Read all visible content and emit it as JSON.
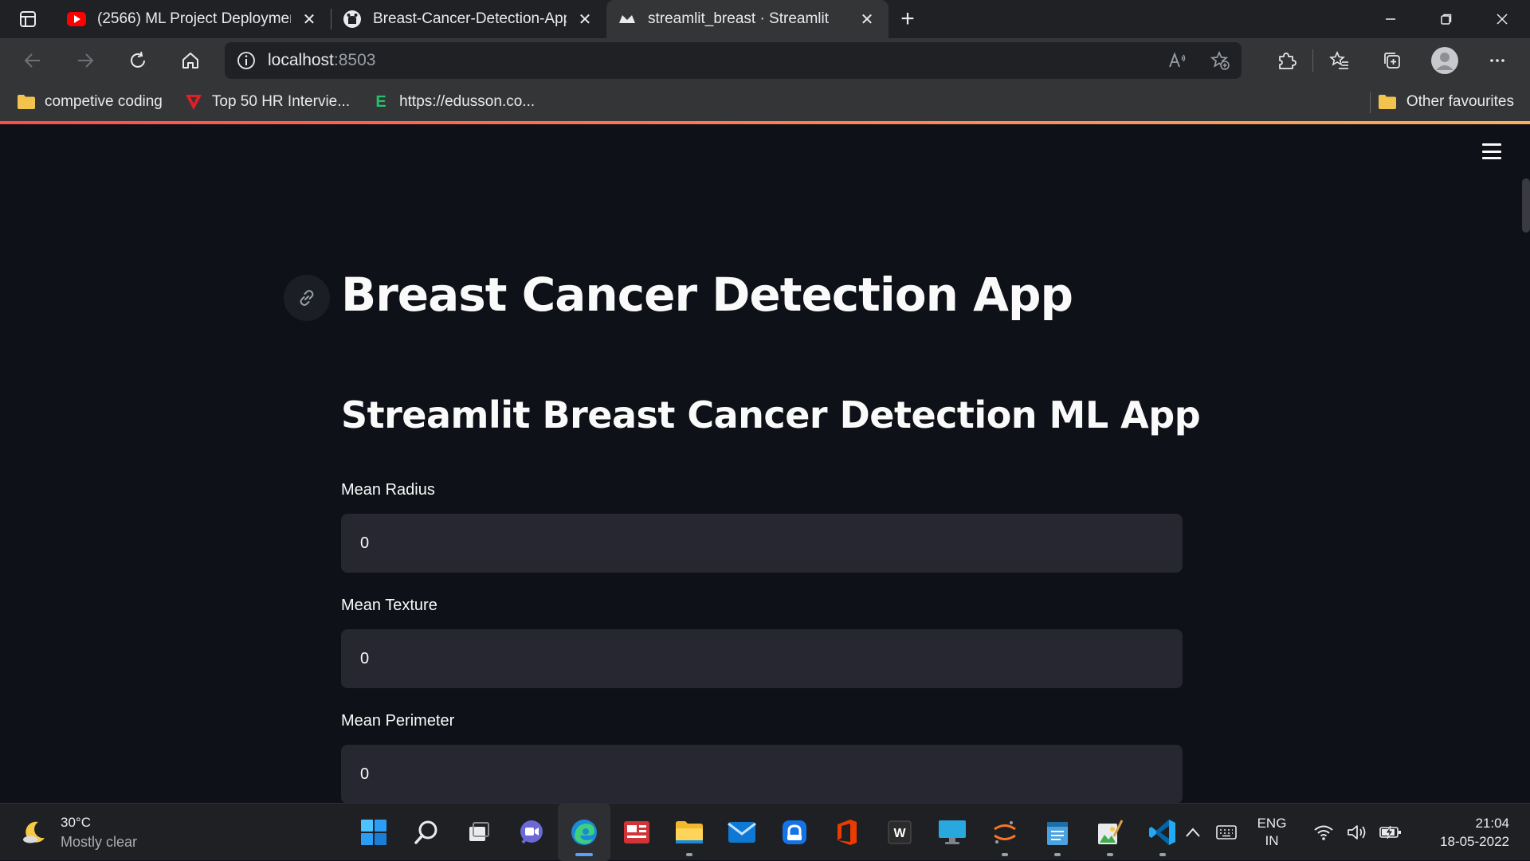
{
  "browser": {
    "tabs": [
      {
        "title": "(2566) ML Project Deployment U",
        "icon": "youtube-icon"
      },
      {
        "title": "Breast-Cancer-Detection-App/ap",
        "icon": "github-icon"
      },
      {
        "title": "streamlit_breast · Streamlit",
        "icon": "streamlit-icon",
        "active": true
      }
    ],
    "url_host": "localhost",
    "url_port": ":8503",
    "bookmarks": [
      {
        "label": "competive coding",
        "icon": "folder-icon"
      },
      {
        "label": "Top 50 HR Intervie...",
        "icon": "v-logo-icon"
      },
      {
        "label": "https://edusson.co...",
        "icon": "e-logo-icon"
      }
    ],
    "other_favourites": "Other favourites"
  },
  "app": {
    "title": "Breast Cancer Detection App",
    "subtitle": "Streamlit Breast Cancer Detection ML App",
    "fields": [
      {
        "label": "Mean Radius",
        "value": "0"
      },
      {
        "label": "Mean Texture",
        "value": "0"
      },
      {
        "label": "Mean Perimeter",
        "value": "0"
      }
    ]
  },
  "taskbar": {
    "weather_temp": "30°C",
    "weather_cond": "Mostly clear",
    "lang_1": "ENG",
    "lang_2": "IN",
    "time": "21:04",
    "date": "18-05-2022"
  },
  "colors": {
    "background": "#0e1117",
    "input_bg": "#262730",
    "text": "#fafafa",
    "accent_start": "#ff4b4b",
    "accent_end": "#fdad5c"
  }
}
